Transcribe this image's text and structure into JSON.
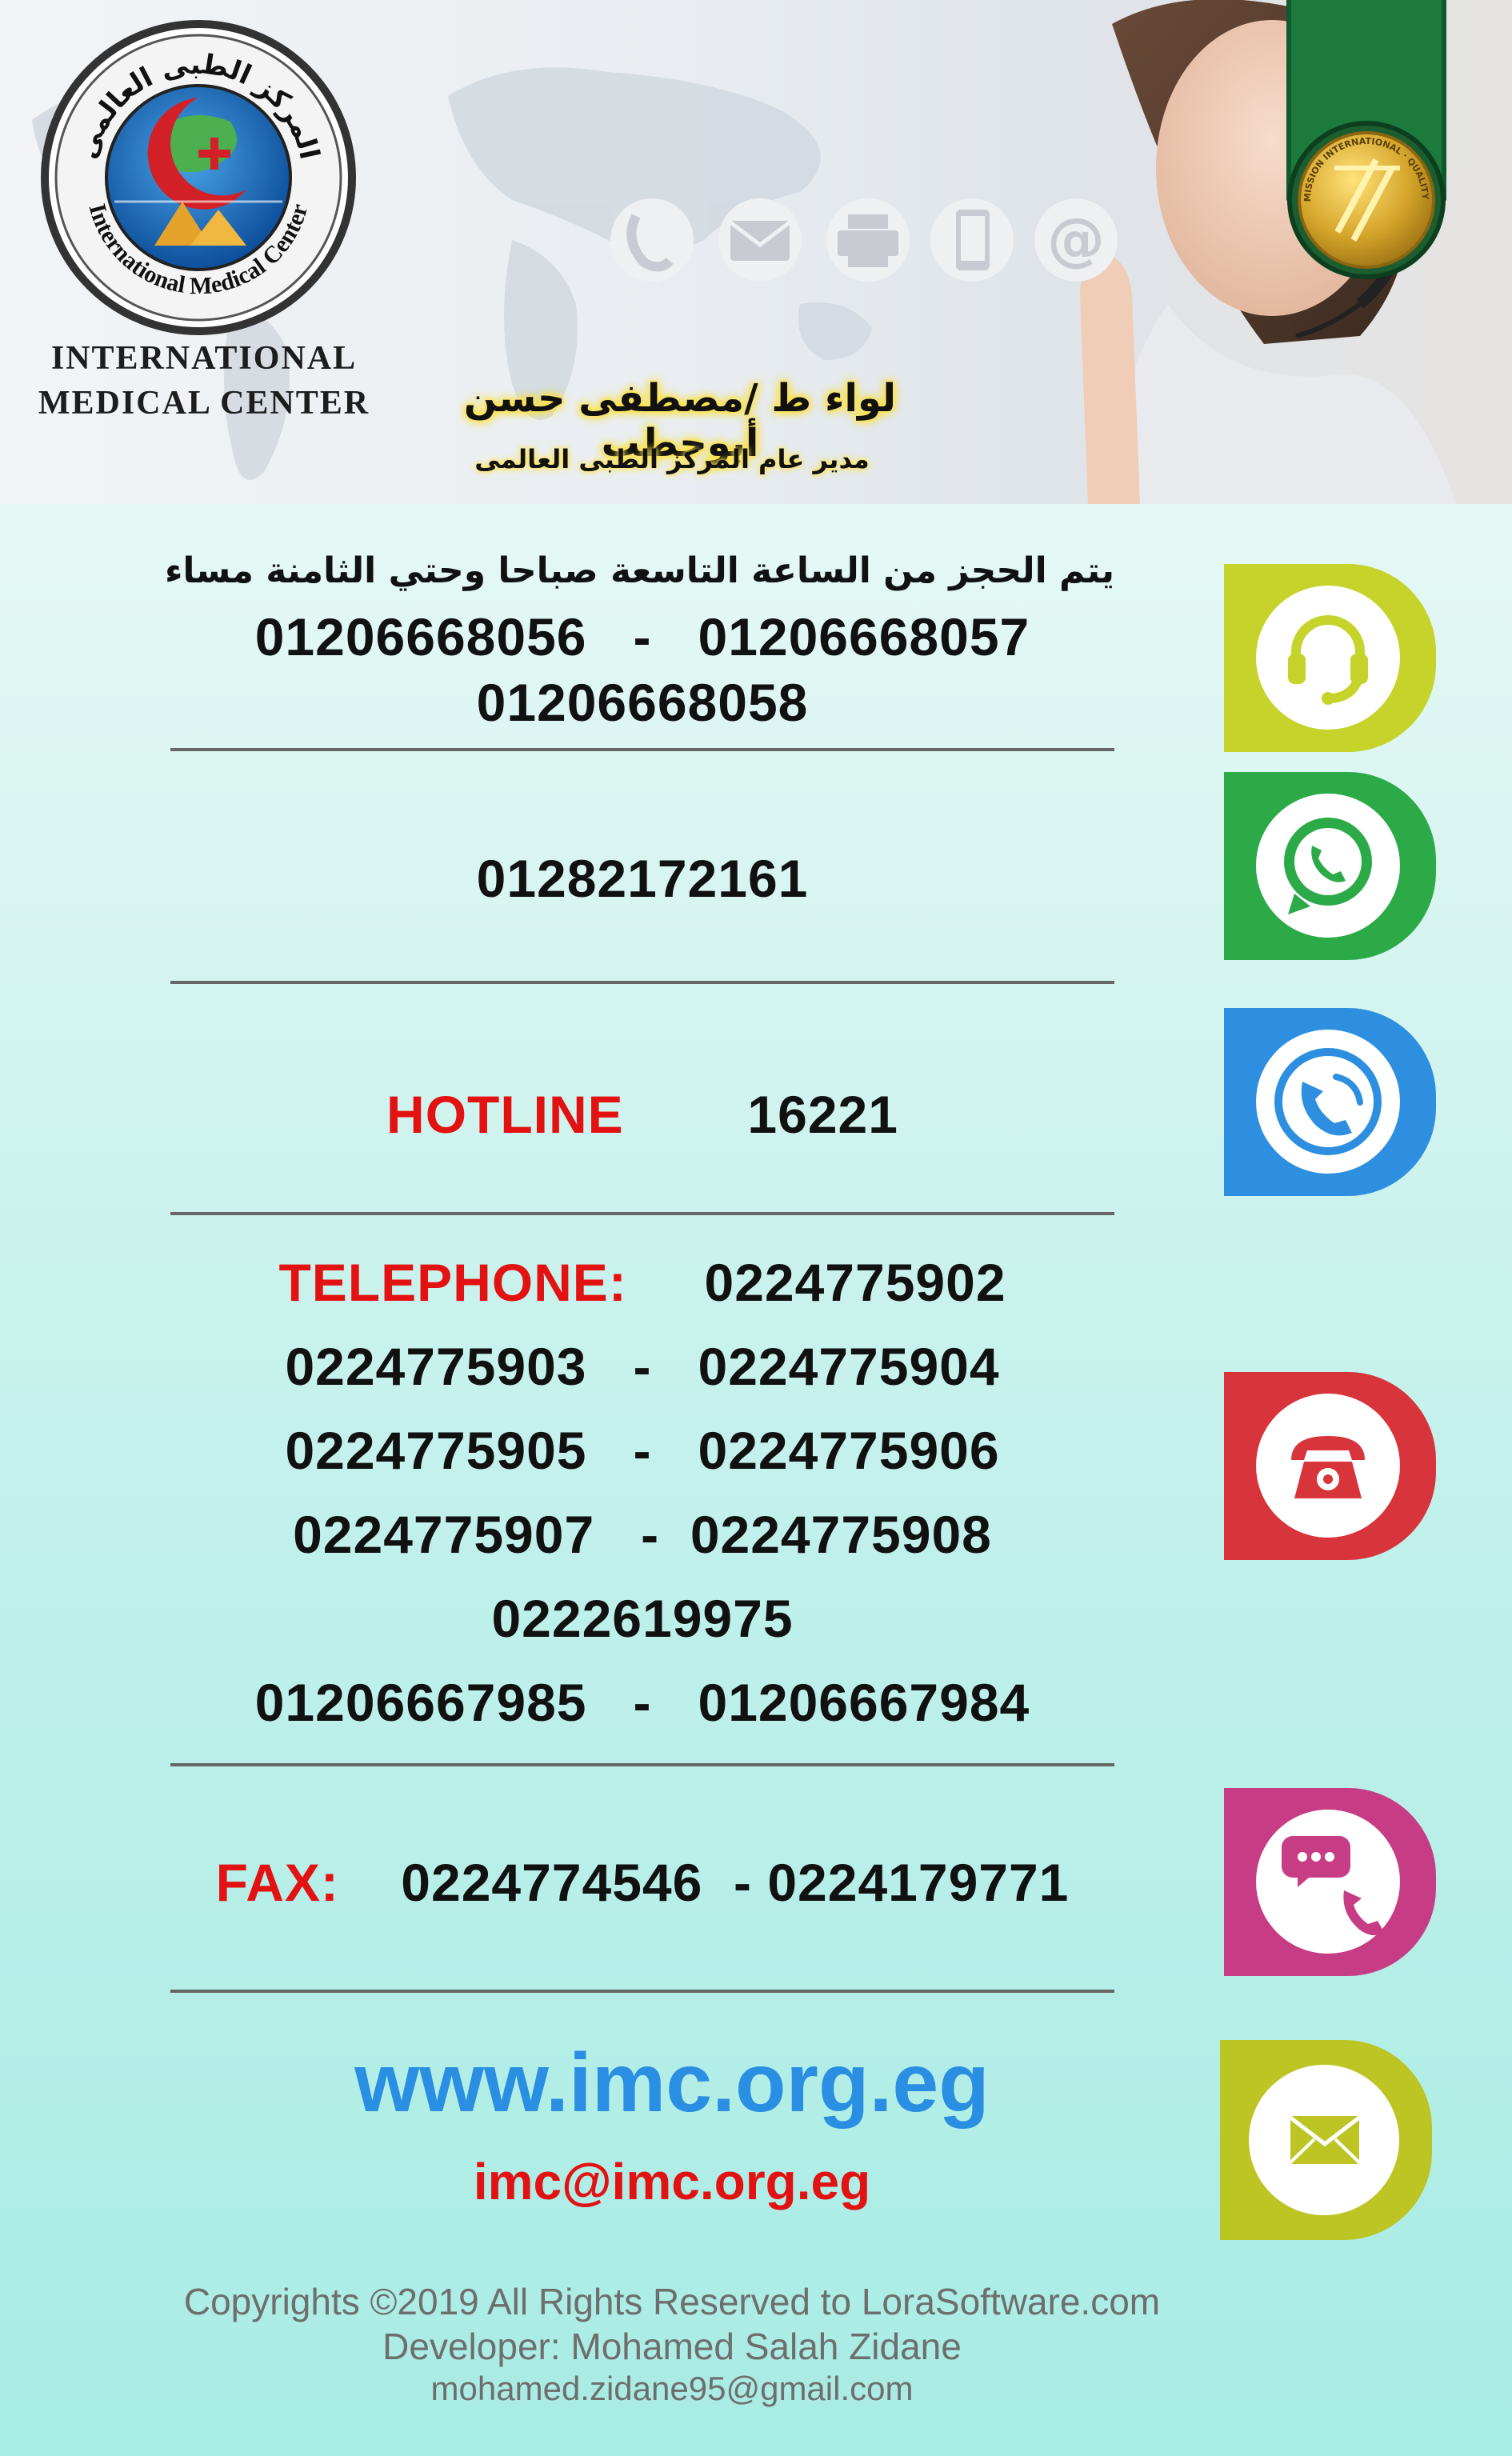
{
  "header": {
    "logo_arabic_text": "المركز الطبى العالمى",
    "logo_english_text": "International Medical Center",
    "org_name_line1": "INTERNATIONAL",
    "org_name_line2": "MEDICAL CENTER",
    "director_name": "لواء ط /مصطفى حسن أبوحطب",
    "director_title": "مدير عام المركز الطبى العالمى",
    "badge_text": "JOINT COMMISSION INTERNATIONAL · QUALITY APPROVAL",
    "header_icons": [
      "phone-icon",
      "mail-icon",
      "printer-icon",
      "mobile-icon",
      "at-icon"
    ]
  },
  "booking": {
    "hours": "يتم الحجز من الساعة التاسعة صباحا وحتي الثامنة مساء",
    "line1": "01206668056   -   01206668057",
    "line2": "01206668058",
    "icon": "headset-support-icon"
  },
  "whatsapp": {
    "number": "01282172161",
    "icon": "whatsapp-icon"
  },
  "hotline": {
    "label": "HOTLINE",
    "number": "16221",
    "icon": "phone-call-icon"
  },
  "telephone": {
    "label": "TELEPHONE:",
    "first": "0224775902",
    "lines": [
      "0224775903   -   0224775904",
      "0224775905   -   0224775906",
      "0224775907   -  0224775908",
      "0222619975",
      "01206667985   -   01206667984"
    ],
    "icon": "telephone-icon"
  },
  "fax": {
    "label": "FAX:",
    "numbers": "0224774546  - 0224179771",
    "icon": "fax-chat-icon"
  },
  "web": {
    "website": "www.imc.org.eg",
    "email": "imc@imc.org.eg",
    "icon": "envelope-icon"
  },
  "footer": {
    "copyright": "Copyrights ©2019 All Rights Reserved to LoraSoftware.com",
    "developer": "Developer: Mohamed Salah Zidane",
    "developer_email": "mohamed.zidane95@gmail.com"
  },
  "colors": {
    "yellow_green": "#c6d32a",
    "green": "#2daa48",
    "blue": "#2e8fe0",
    "red": "#d8343b",
    "magenta": "#c63d86",
    "olive": "#bdc524",
    "accent_red": "#e31212",
    "link_blue": "#2a8fe2"
  }
}
